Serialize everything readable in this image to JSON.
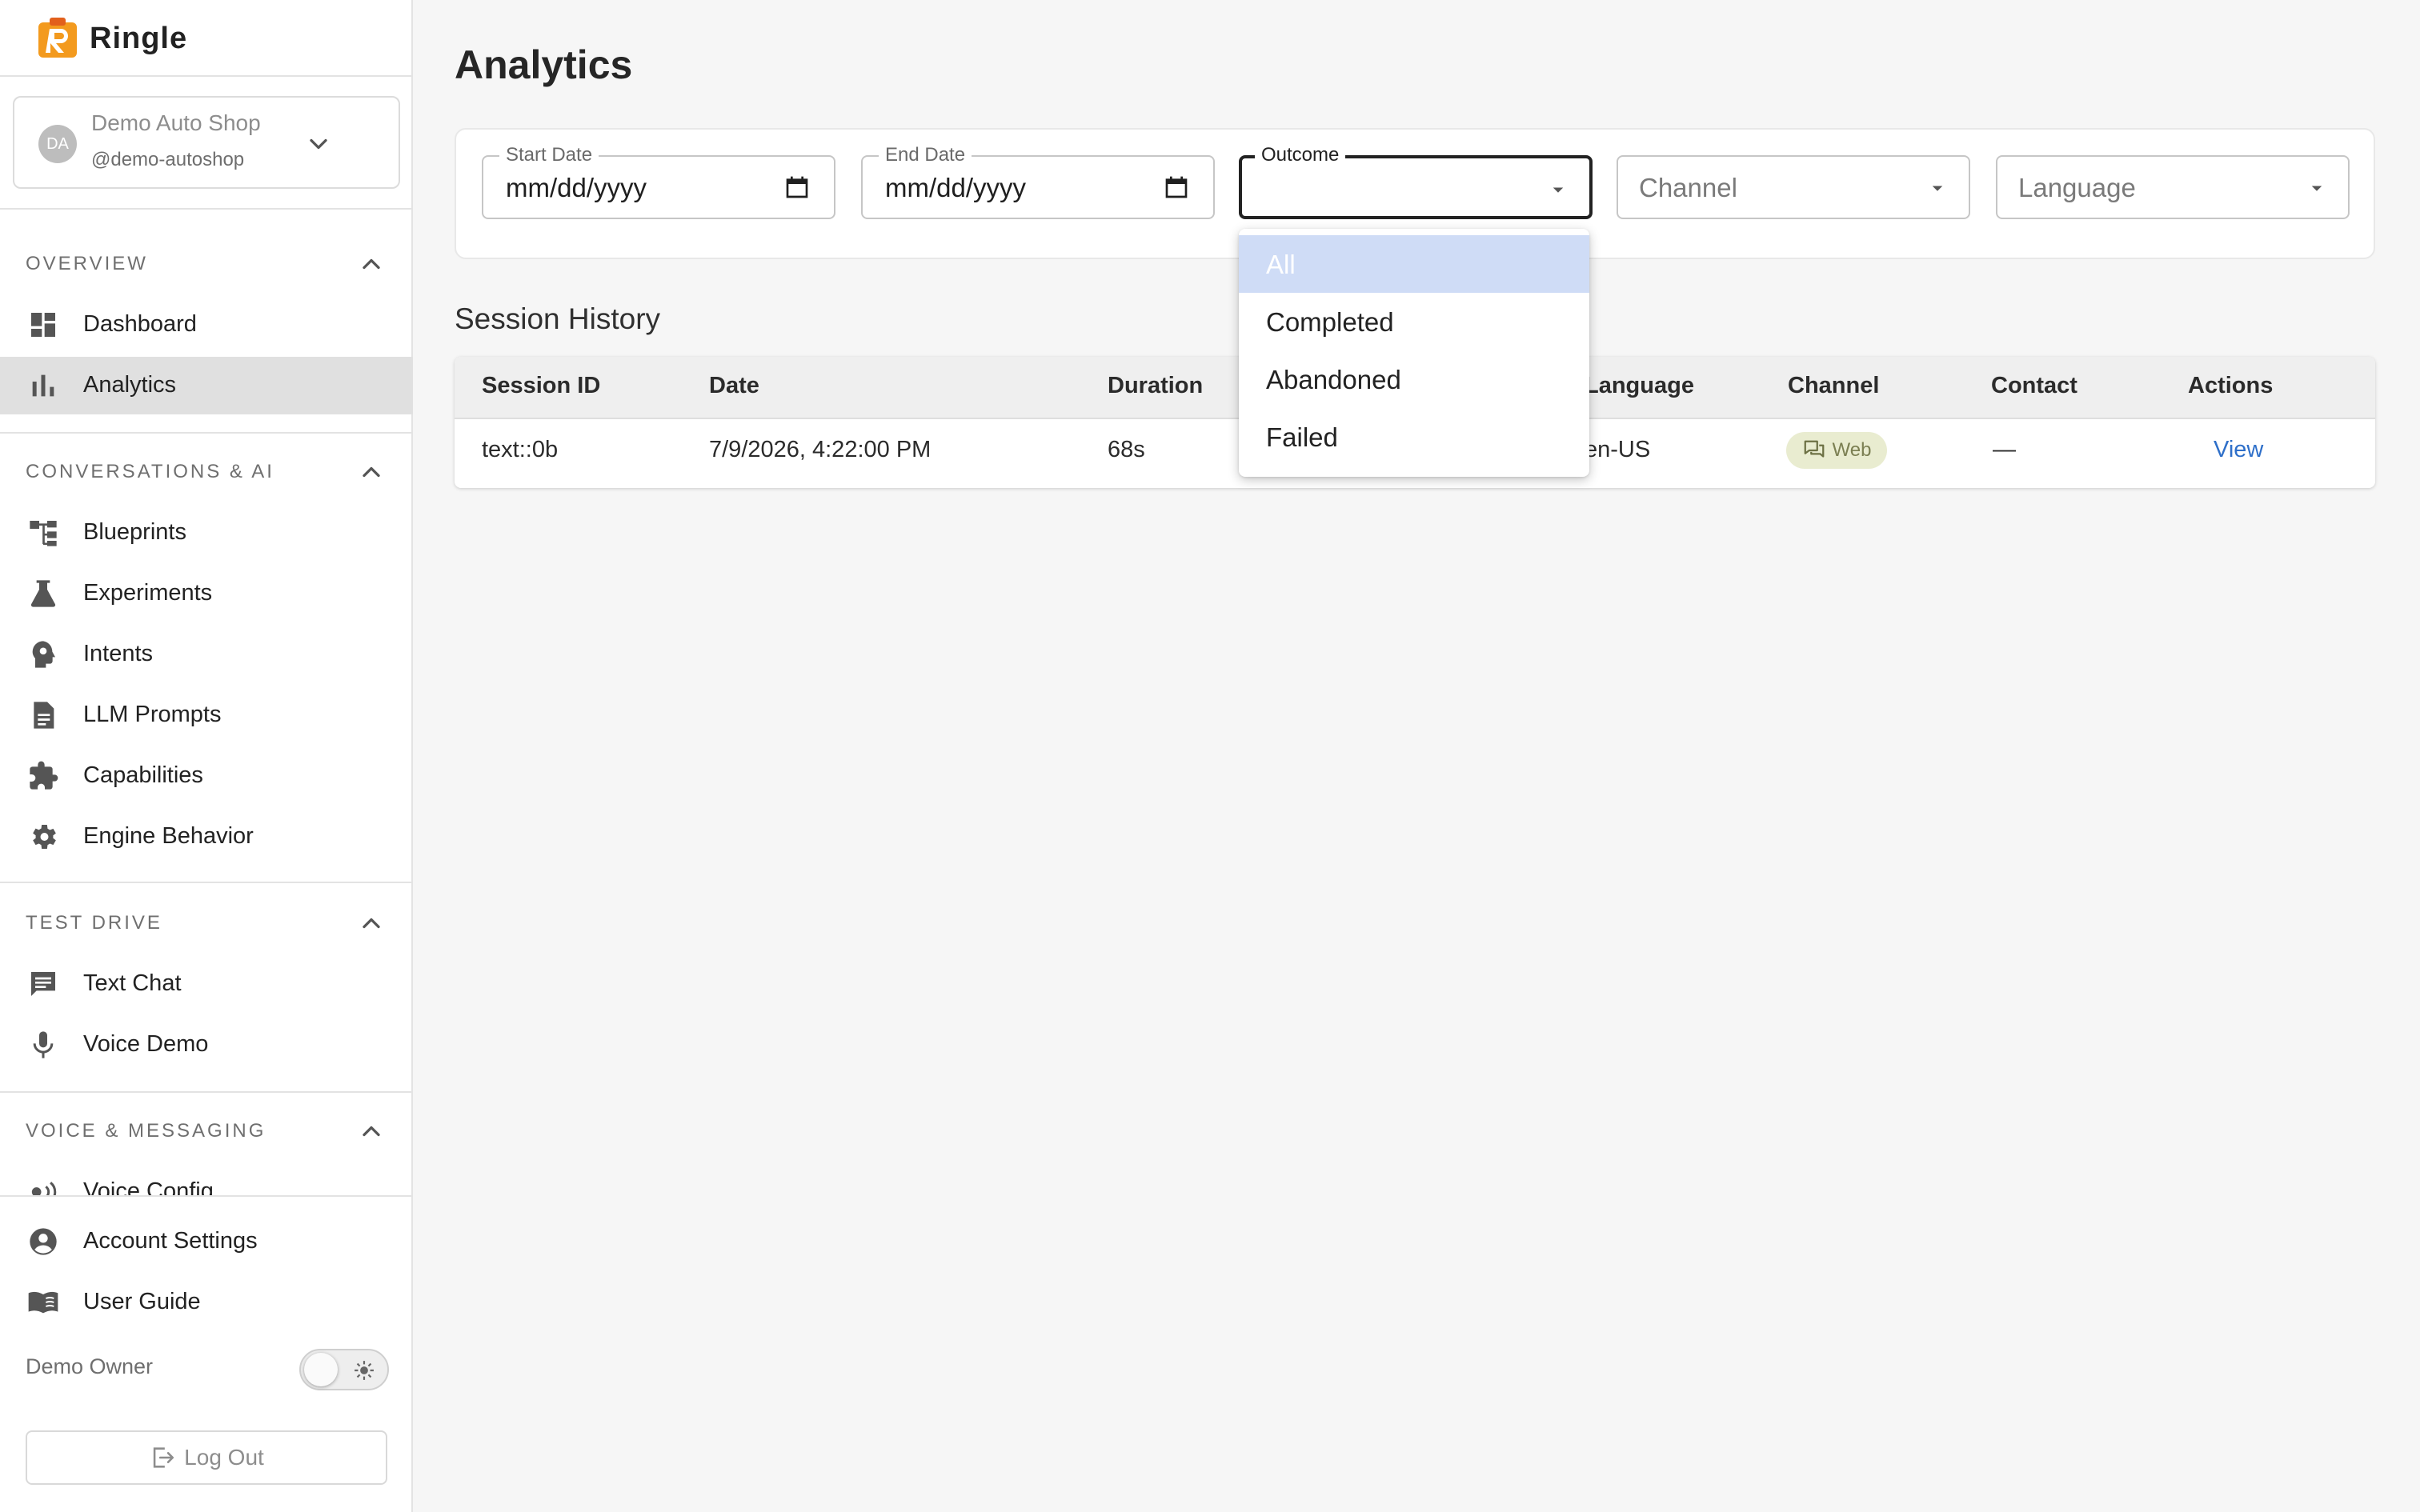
{
  "brand": {
    "name": "Ringle",
    "logo_letter": "R",
    "accent": "#f39a1e"
  },
  "account": {
    "initials": "DA",
    "name": "Demo Auto Shop",
    "handle": "@demo-autoshop"
  },
  "sidebar": {
    "sections": [
      {
        "label": "OVERVIEW",
        "items": [
          {
            "label": "Dashboard"
          },
          {
            "label": "Analytics"
          }
        ]
      },
      {
        "label": "CONVERSATIONS & AI",
        "items": [
          {
            "label": "Blueprints"
          },
          {
            "label": "Experiments"
          },
          {
            "label": "Intents"
          },
          {
            "label": "LLM Prompts"
          },
          {
            "label": "Capabilities"
          },
          {
            "label": "Engine Behavior"
          }
        ]
      },
      {
        "label": "TEST DRIVE",
        "items": [
          {
            "label": "Text Chat"
          },
          {
            "label": "Voice Demo"
          }
        ]
      },
      {
        "label": "VOICE & MESSAGING",
        "items": [
          {
            "label": "Voice Config"
          }
        ]
      }
    ],
    "active_item": "Analytics",
    "footer": {
      "account_settings": "Account Settings",
      "user_guide": "User Guide",
      "owner": "Demo Owner",
      "logout": "Log Out"
    }
  },
  "page": {
    "title": "Analytics"
  },
  "filters": {
    "start_date": {
      "label": "Start Date",
      "value": "mm/dd/yyyy"
    },
    "end_date": {
      "label": "End Date",
      "value": "mm/dd/yyyy"
    },
    "outcome": {
      "label": "Outcome",
      "value": ""
    },
    "channel": {
      "placeholder": "Channel"
    },
    "language": {
      "placeholder": "Language"
    }
  },
  "outcome_menu": {
    "options": [
      "All",
      "Completed",
      "Abandoned",
      "Failed"
    ],
    "highlighted": "All"
  },
  "session_history": {
    "title": "Session History",
    "columns": [
      "Session ID",
      "Date",
      "Duration",
      "Language",
      "Channel",
      "Contact",
      "Actions"
    ],
    "rows": [
      {
        "session_id": "text::0b",
        "date": "7/9/2026, 4:22:00 PM",
        "duration": "68s",
        "language": "en-US",
        "channel": "Web",
        "contact": "—",
        "action": "View"
      }
    ]
  },
  "colors": {
    "link": "#2e6fc9",
    "active_nav_bg": "#e0e0e0",
    "menu_highlight": "#cfdcf6",
    "web_chip_bg": "#e9ecd0"
  }
}
